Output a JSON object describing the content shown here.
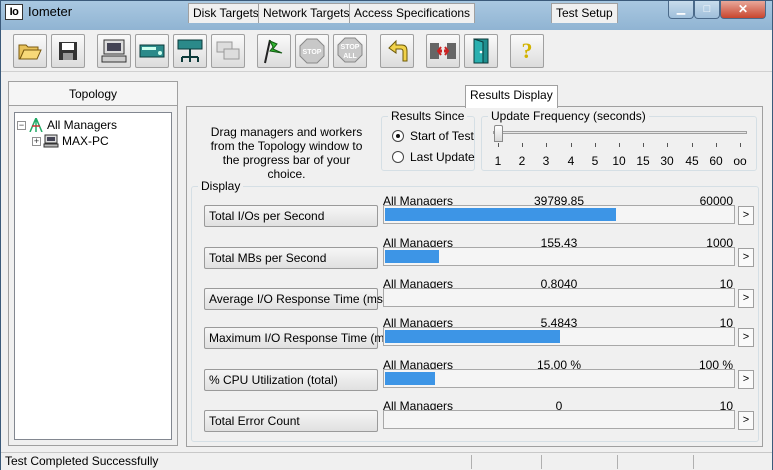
{
  "window": {
    "title": "Iometer",
    "icon_text": "Io"
  },
  "toolbar": {
    "buttons": [
      {
        "name": "open-config-button",
        "icon": "folder-open-icon"
      },
      {
        "name": "save-config-button",
        "icon": "floppy-disk-icon"
      },
      {
        "name": "show-batch-button",
        "icon": "monitor-icon"
      },
      {
        "name": "new-disk-worker-button",
        "icon": "disk-worker-icon"
      },
      {
        "name": "new-network-worker-button",
        "icon": "network-worker-icon"
      },
      {
        "name": "duplicate-worker-button",
        "icon": "duplicate-icon"
      },
      {
        "name": "start-tests-button",
        "icon": "green-flag-icon"
      },
      {
        "name": "stop-button",
        "icon": "stop-sign-icon",
        "label": "STOP"
      },
      {
        "name": "stop-all-button",
        "icon": "stop-all-sign-icon",
        "label": "STOP",
        "sublabel": "ALL"
      },
      {
        "name": "reset-workers-button",
        "icon": "reset-arrow-icon"
      },
      {
        "name": "disconnect-button",
        "icon": "disconnect-icon"
      },
      {
        "name": "exit-button",
        "icon": "exit-door-icon"
      },
      {
        "name": "help-button",
        "icon": "help-question-icon",
        "label": "?"
      }
    ]
  },
  "topology": {
    "header": "Topology",
    "root": {
      "label": "All Managers",
      "expander": "−"
    },
    "children": [
      {
        "label": "MAX-PC",
        "expander": "+"
      }
    ]
  },
  "tabs": [
    {
      "label": "Disk Targets",
      "active": false
    },
    {
      "label": "Network Targets",
      "active": false
    },
    {
      "label": "Access Specifications",
      "active": false
    },
    {
      "label": "Results Display",
      "active": true
    },
    {
      "label": "Test Setup",
      "active": false
    }
  ],
  "results": {
    "instructions": "Drag managers and workers from the Topology window to the progress bar of your choice.",
    "results_since": {
      "title": "Results Since",
      "options": [
        {
          "label": "Start of Test",
          "checked": true
        },
        {
          "label": "Last Update",
          "checked": false
        }
      ]
    },
    "update_frequency": {
      "title": "Update Frequency (seconds)",
      "ticks": [
        "1",
        "2",
        "3",
        "4",
        "5",
        "10",
        "15",
        "30",
        "45",
        "60",
        "oo"
      ],
      "selected_index": 0
    },
    "display_title": "Display",
    "metrics": [
      {
        "button": "Total I/Os per Second",
        "source": "All Managers",
        "value": "39789.85",
        "max": "60000",
        "fill": 0.663
      },
      {
        "button": "Total MBs per Second",
        "source": "All Managers",
        "value": "155.43",
        "max": "1000",
        "fill": 0.155
      },
      {
        "button": "Average I/O Response Time (ms)",
        "source": "All Managers",
        "value": "0.8040",
        "max": "10",
        "fill": 0.0
      },
      {
        "button": "Maximum I/O Response Time (ms)",
        "source": "All Managers",
        "value": "5.4843",
        "max": "10",
        "fill": 0.502
      },
      {
        "button": "% CPU Utilization (total)",
        "source": "All Managers",
        "value": "15.00 %",
        "max": "100 %",
        "fill": 0.143
      },
      {
        "button": "Total Error Count",
        "source": "All Managers",
        "value": "0",
        "max": "10",
        "fill": 0.0
      }
    ],
    "arrow_label": ">"
  },
  "status": {
    "text": "Test Completed Successfully"
  },
  "colors": {
    "bar": "#3d95e6",
    "titlebar": "#a9c8e1",
    "close": "#c8452e"
  }
}
